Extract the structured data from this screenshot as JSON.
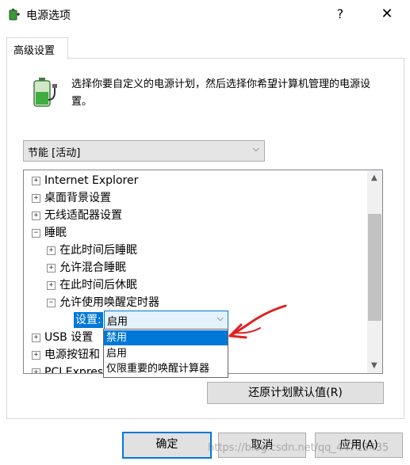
{
  "window": {
    "title": "电源选项",
    "help_label": "?",
    "close_label": "✕"
  },
  "tabs": [
    {
      "label": "高级设置"
    }
  ],
  "intro": {
    "text": "选择你要自定义的电源计划，然后选择你希望计算机管理的电源设置。"
  },
  "plan": {
    "selected": "节能 [活动]"
  },
  "tree": {
    "items": [
      {
        "label": "Internet Explorer",
        "expander": "+"
      },
      {
        "label": "桌面背景设置",
        "expander": "+"
      },
      {
        "label": "无线适配器设置",
        "expander": "+"
      },
      {
        "label": "睡眠",
        "expander": "−"
      },
      {
        "label": "在此时间后睡眠",
        "expander": "+"
      },
      {
        "label": "允许混合睡眠",
        "expander": "+"
      },
      {
        "label": "在此时间后休眠",
        "expander": "+"
      },
      {
        "label": "允许使用唤醒定时器",
        "expander": "−"
      },
      {
        "label": "USB 设置",
        "expander": "+"
      },
      {
        "label": "电源按钮和",
        "expander": "+"
      },
      {
        "label": "PCI Express",
        "expander": "+"
      }
    ],
    "setting_label": "设置:",
    "setting_value": "启用"
  },
  "dropdown": {
    "options": [
      "禁用",
      "启用",
      "仅限重要的唤醒计算器"
    ],
    "highlighted": "禁用"
  },
  "buttons": {
    "restore": "还原计划默认值(R)",
    "ok": "确定",
    "cancel": "取消",
    "apply": "应用(A)"
  },
  "watermark": "https://blog.csdn.net/qq_44713435",
  "colors": {
    "accent": "#0078d7",
    "annotation": "#e02020"
  },
  "icons": [
    "power-options-icon",
    "battery-plug-icon",
    "chevron-down-icon",
    "scroll-up-icon",
    "scroll-down-icon"
  ]
}
